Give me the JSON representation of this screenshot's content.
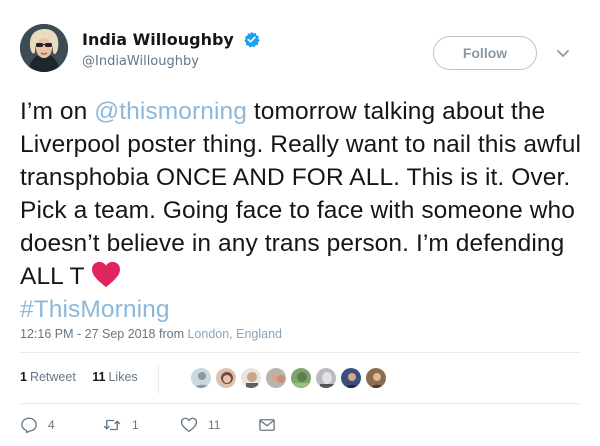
{
  "user": {
    "display_name": "India Willoughby",
    "handle": "@IndiaWilloughby",
    "verified": true
  },
  "follow_label": "Follow",
  "tweet": {
    "part1": "I’m on ",
    "mention": "@thismorning",
    "part2": " tomorrow talking about the Liverpool poster thing. Really want to nail this awful transphobia ONCE AND FOR ALL. This is it. Over. Pick a team. Going face to face with someone who doesn’t believe in any trans person. I’m defending ALL T ",
    "hashtag": "#ThisMorning"
  },
  "meta": {
    "time": "12:16 PM - 27 Sep 2018",
    "from": " from ",
    "location": "London, England"
  },
  "stats": {
    "retweets_count": "1",
    "retweets_label": "Retweet",
    "likes_count": "11",
    "likes_label": "Likes"
  },
  "actions": {
    "replies": "4",
    "retweets": "1",
    "likes": "11"
  },
  "colors": {
    "link": "#8bb8db",
    "verified": "#1da1f2",
    "heart": "#e0245e"
  }
}
